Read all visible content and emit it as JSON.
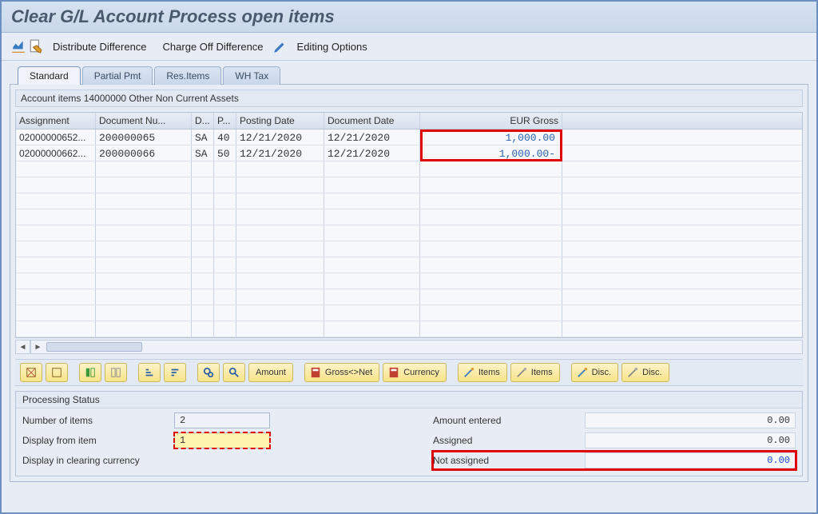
{
  "title": "Clear G/L Account Process open items",
  "toolbar": {
    "distribute": "Distribute Difference",
    "chargeoff": "Charge Off Difference",
    "editing": "Editing Options"
  },
  "tabs": {
    "standard": "Standard",
    "partial": "Partial Pmt",
    "res": "Res.Items",
    "wh": "WH Tax"
  },
  "section_header": "Account items 14000000 Other Non Current Assets",
  "columns": {
    "assignment": "Assignment",
    "docnum": "Document Nu...",
    "d": "D...",
    "p": "P...",
    "pdate": "Posting Date",
    "ddate": "Document Date",
    "amount": "EUR Gross"
  },
  "rows": [
    {
      "assignment": "02000000652...",
      "docnum": "200000065",
      "d": "SA",
      "p": "40",
      "pdate": "12/21/2020",
      "ddate": "12/21/2020",
      "amount": "1,000.00"
    },
    {
      "assignment": "02000000662...",
      "docnum": "200000066",
      "d": "SA",
      "p": "50",
      "pdate": "12/21/2020",
      "ddate": "12/21/2020",
      "amount": "1,000.00-"
    }
  ],
  "buttons": {
    "amount": "Amount",
    "grossnet": "Gross<>Net",
    "currency": "Currency",
    "items1": "Items",
    "items2": "Items",
    "disc1": "Disc.",
    "disc2": "Disc."
  },
  "status": {
    "title": "Processing Status",
    "numitems_label": "Number of items",
    "numitems_value": "2",
    "displayfrom_label": "Display from item",
    "displayfrom_value": "1",
    "displaycurr_label": "Display in clearing currency",
    "amount_entered_label": "Amount entered",
    "amount_entered_value": "0.00",
    "assigned_label": "Assigned",
    "assigned_value": "0.00",
    "notassigned_label": "Not assigned",
    "notassigned_value": "0.00"
  }
}
